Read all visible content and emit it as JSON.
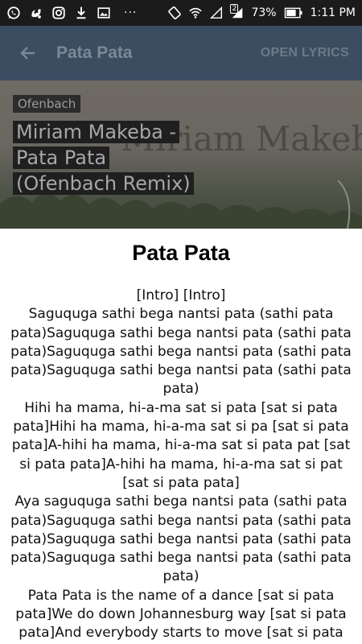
{
  "status_bar": {
    "left_icons": [
      "whatsapp-icon",
      "uc-browser-icon",
      "instagram-icon",
      "download-icon",
      "gallery-icon"
    ],
    "more": "···",
    "battery_percent": "73%",
    "sim_badge": "2",
    "time": "1:11 PM"
  },
  "toolbar": {
    "title": "Pata Pata",
    "action_label": "OPEN LYRICS"
  },
  "hero": {
    "artist": "Ofenbach",
    "song_title": "Miriam Makeba - Pata Pata (Ofenbach Remix)",
    "watermark": "Miriam Makeba"
  },
  "dialog": {
    "title": "Pata Pata",
    "lyrics": "[Intro] [Intro]\nSaguquga sathi bega nantsi pata (sathi pata pata)Saguquga sathi bega nantsi pata (sathi pata pata)Saguquga sathi bega nantsi pata (sathi pata pata)Saguquga sathi bega nantsi pata (sathi pata pata)\nHihi ha mama, hi-a-ma sat si pata [sat si pata pata]Hihi ha mama, hi-a-ma sat si pa [sat si pata pata]A-hihi ha mama, hi-a-ma sat si pata pat [sat si pata pata]A-hihi ha mama, hi-a-ma sat si pat [sat si pata pata]\nAya saguquga sathi bega nantsi pata (sathi pata pata)Saguquga sathi bega nantsi pata (sathi pata pata)Saguquga sathi bega nantsi pata (sathi pata pata)Saguquga sathi bega nantsi pata (sathi pata pata)\nPata Pata is the name of a dance [sat si pata pata]We do down Johannesburg way [sat si pata pata]And everybody starts to move [sat si pata pata]"
  }
}
